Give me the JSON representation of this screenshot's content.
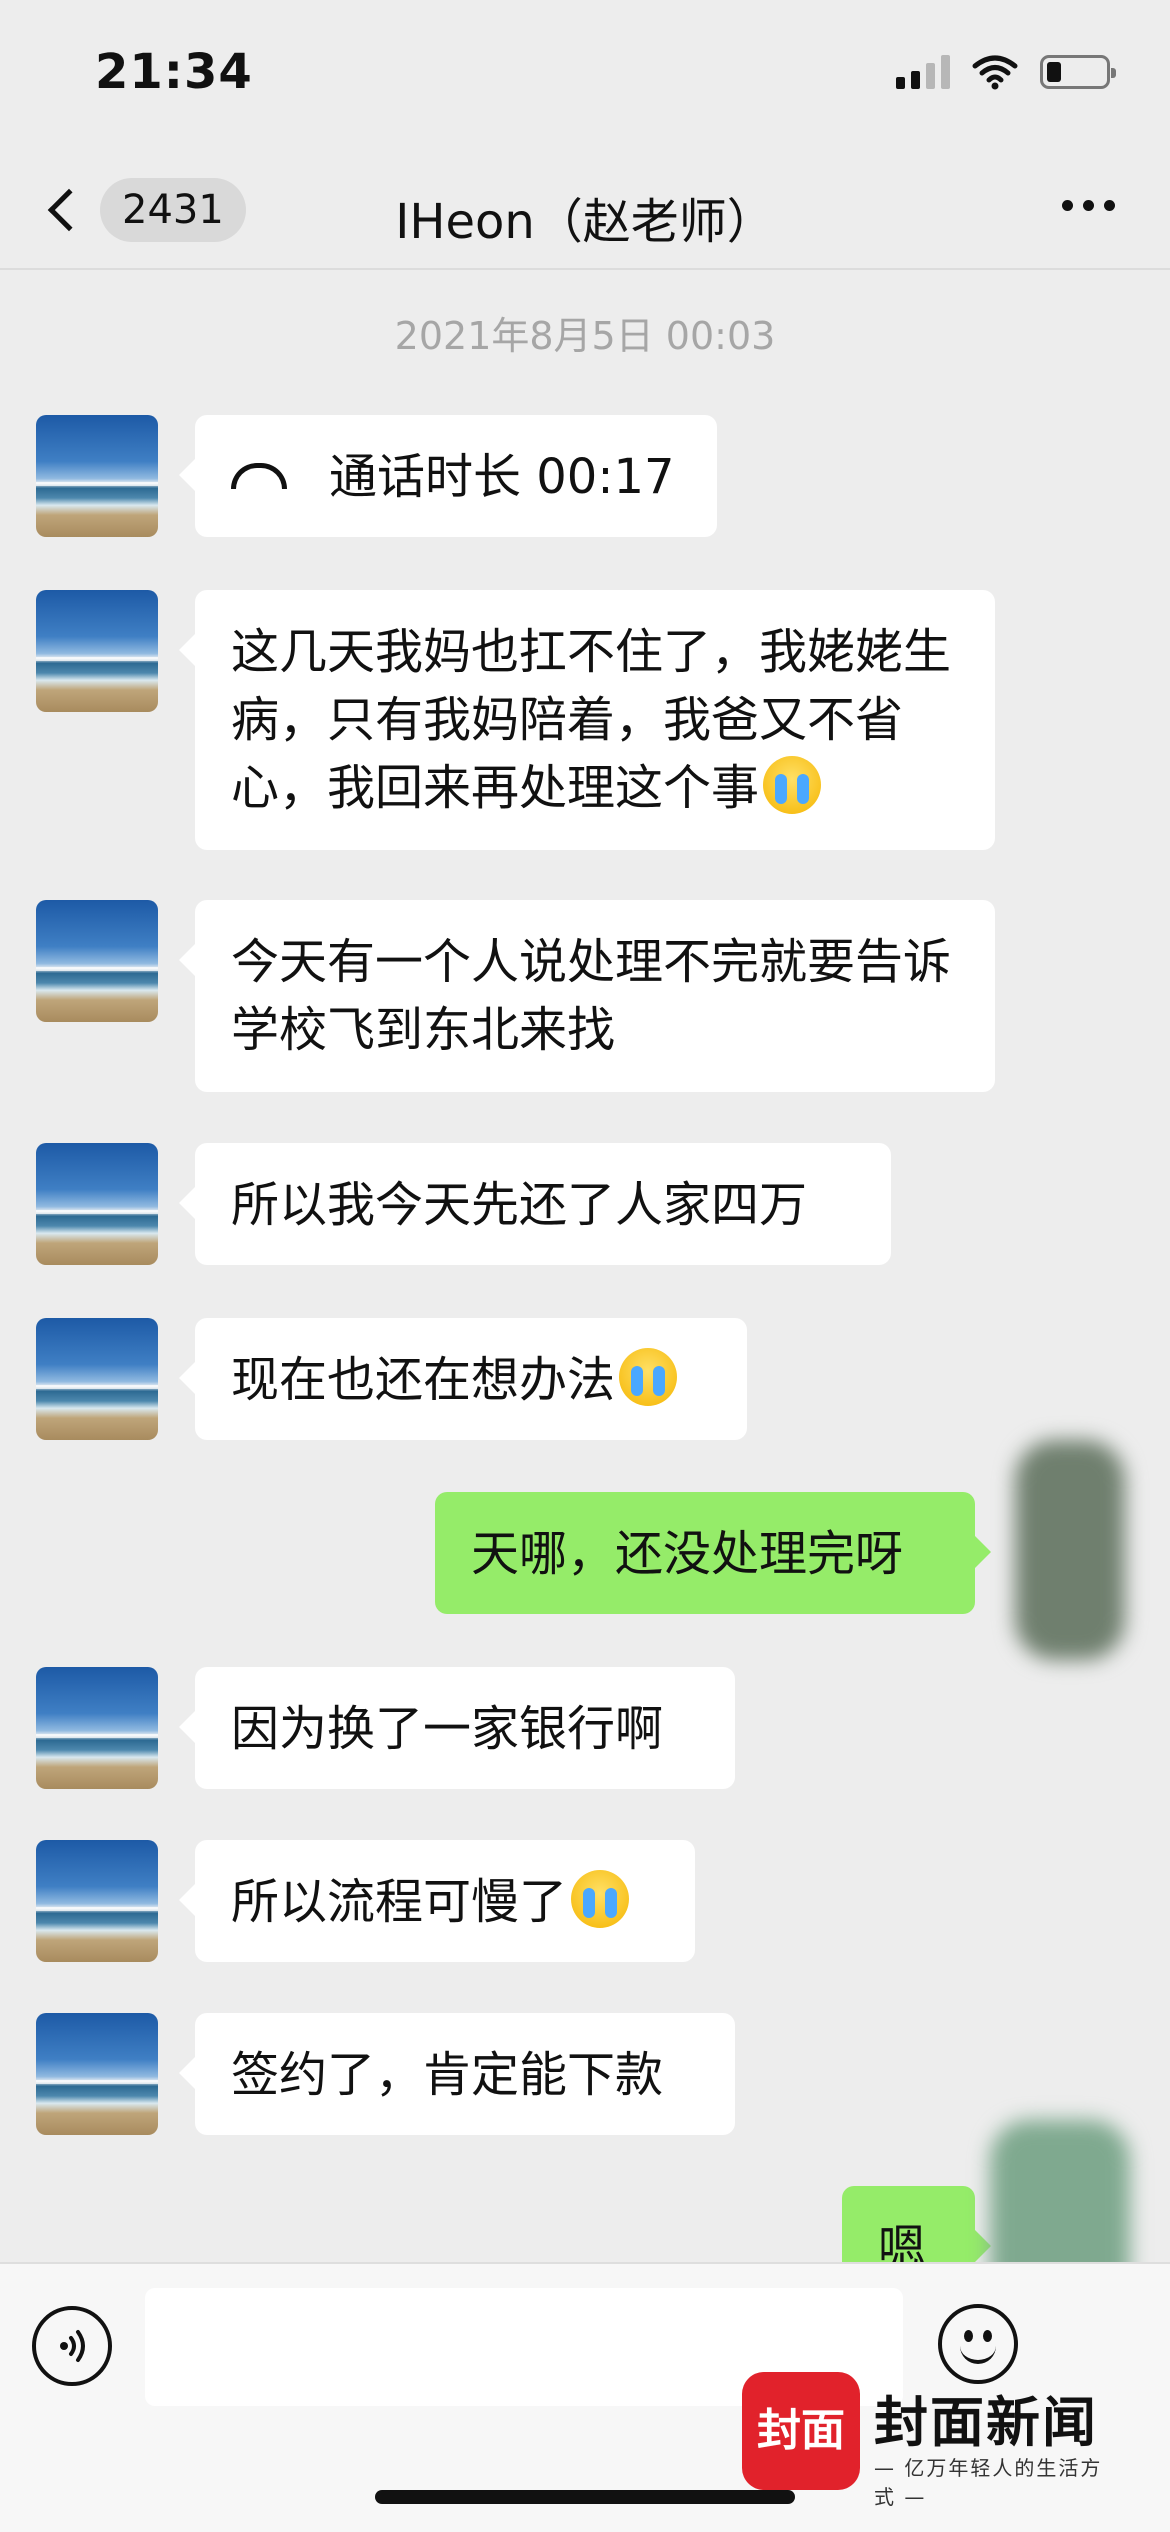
{
  "status_bar": {
    "time": "21:34"
  },
  "nav": {
    "back_count": "2431",
    "title": "IHeon（赵老师）"
  },
  "timestamp": "2021年8月5日 00:03",
  "messages": [
    {
      "side": "in",
      "text": "通话时长 00:17",
      "icon": "phone-hangup-icon"
    },
    {
      "side": "in",
      "text": "这几天我妈也扛不住了，我姥姥生病，只有我妈陪着，我爸又不省心，我回来再处理这个事",
      "emoji": "loudly-crying-face"
    },
    {
      "side": "in",
      "text": "今天有一个人说处理不完就要告诉学校飞到东北来找"
    },
    {
      "side": "in",
      "text": "所以我今天先还了人家四万"
    },
    {
      "side": "in",
      "text": "现在也还在想办法",
      "emoji": "loudly-crying-face"
    },
    {
      "side": "out",
      "text": "天哪，还没处理完呀"
    },
    {
      "side": "in",
      "text": "因为换了一家银行啊"
    },
    {
      "side": "in",
      "text": "所以流程可慢了",
      "emoji": "loudly-crying-face"
    },
    {
      "side": "in",
      "text": "签约了，肯定能下款"
    },
    {
      "side": "out",
      "text": "嗯"
    }
  ],
  "input_bar": {
    "voice_icon": "voice-icon",
    "emoji_icon": "emoji-icon"
  },
  "watermark": {
    "badge": "封面",
    "name": "封面新闻",
    "slogan": "— 亿万年轻人的生活方式 —"
  },
  "colors": {
    "incoming_bubble": "#ffffff",
    "outgoing_bubble": "#95ec69",
    "background": "#ededed",
    "logo_red": "#e1222b"
  }
}
